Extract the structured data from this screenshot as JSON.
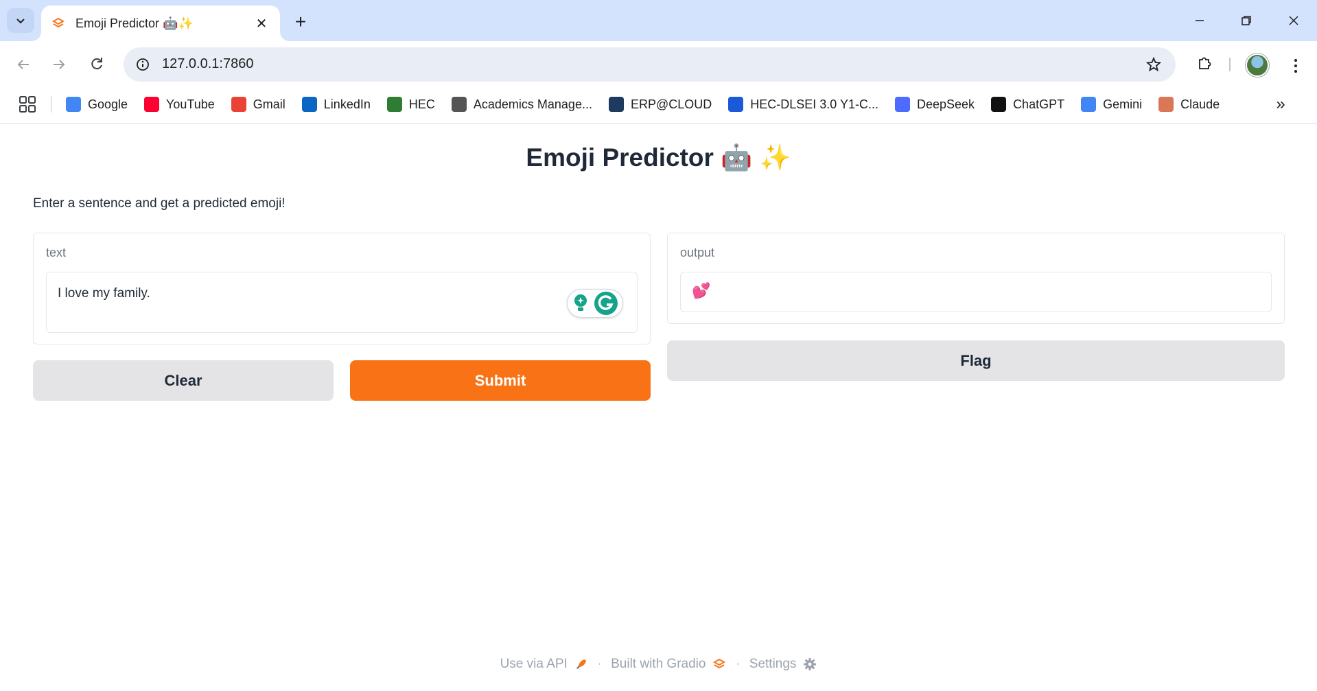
{
  "browser": {
    "tab_title": "Emoji Predictor 🤖✨",
    "url": "127.0.0.1:7860",
    "bookmarks": [
      {
        "label": "Google",
        "icon": "google-icon",
        "color": "#4285f4"
      },
      {
        "label": "YouTube",
        "icon": "youtube-icon",
        "color": "#ff0033"
      },
      {
        "label": "Gmail",
        "icon": "gmail-icon",
        "color": "#ea4335"
      },
      {
        "label": "LinkedIn",
        "icon": "linkedin-icon",
        "color": "#0a66c2"
      },
      {
        "label": "HEC",
        "icon": "hec-icon",
        "color": "#2e7d32"
      },
      {
        "label": "Academics Manage...",
        "icon": "academics-icon",
        "color": "#555555"
      },
      {
        "label": "ERP@CLOUD",
        "icon": "erp-icon",
        "color": "#1e3a5f"
      },
      {
        "label": "HEC-DLSEI 3.0 Y1-C...",
        "icon": "hec-dlsei-icon",
        "color": "#1a5ad8"
      },
      {
        "label": "DeepSeek",
        "icon": "deepseek-icon",
        "color": "#4d6bfe"
      },
      {
        "label": "ChatGPT",
        "icon": "chatgpt-icon",
        "color": "#111111"
      },
      {
        "label": "Gemini",
        "icon": "gemini-icon",
        "color": "#4285f4"
      },
      {
        "label": "Claude",
        "icon": "claude-icon",
        "color": "#d97757"
      }
    ]
  },
  "app": {
    "title": "Emoji Predictor 🤖 ✨",
    "description": "Enter a sentence and get a predicted emoji!",
    "input": {
      "label": "text",
      "value": "I love my family."
    },
    "output": {
      "label": "output",
      "value": "💕"
    },
    "buttons": {
      "clear": "Clear",
      "submit": "Submit",
      "flag": "Flag"
    },
    "accent_color": "#f97316"
  },
  "footer": {
    "api": "Use via API",
    "built": "Built with Gradio",
    "settings": "Settings",
    "separator": "·"
  }
}
